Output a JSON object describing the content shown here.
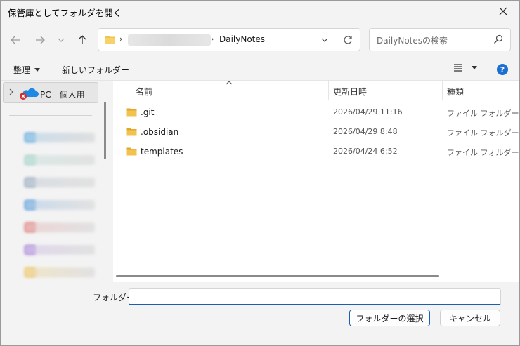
{
  "window": {
    "title": "保管庫としてフォルダを開く"
  },
  "address": {
    "current_folder": "DailyNotes",
    "separator": "›"
  },
  "search": {
    "placeholder": "DailyNotesの検索"
  },
  "toolbar": {
    "organize_label": "整理",
    "new_folder_label": "新しいフォルダー",
    "help_label": "?"
  },
  "navpane": {
    "pc_label": "PC - 個人用"
  },
  "columns": {
    "name": "名前",
    "date": "更新日時",
    "type": "種類"
  },
  "files": [
    {
      "name": ".git",
      "date": "2026/04/29 11:16",
      "type": "ファイル フォルダー"
    },
    {
      "name": ".obsidian",
      "date": "2026/04/29 8:48",
      "type": "ファイル フォルダー"
    },
    {
      "name": "templates",
      "date": "2026/04/24 6:52",
      "type": "ファイル フォルダー"
    }
  ],
  "footer": {
    "folder_label": "フォルダー:",
    "folder_value": "",
    "select_button": "フォルダーの選択",
    "cancel_button": "キャンセル"
  },
  "colors": {
    "accent": "#1a5fb4",
    "folder": "#f2c14e",
    "help": "#1a6fd1"
  }
}
